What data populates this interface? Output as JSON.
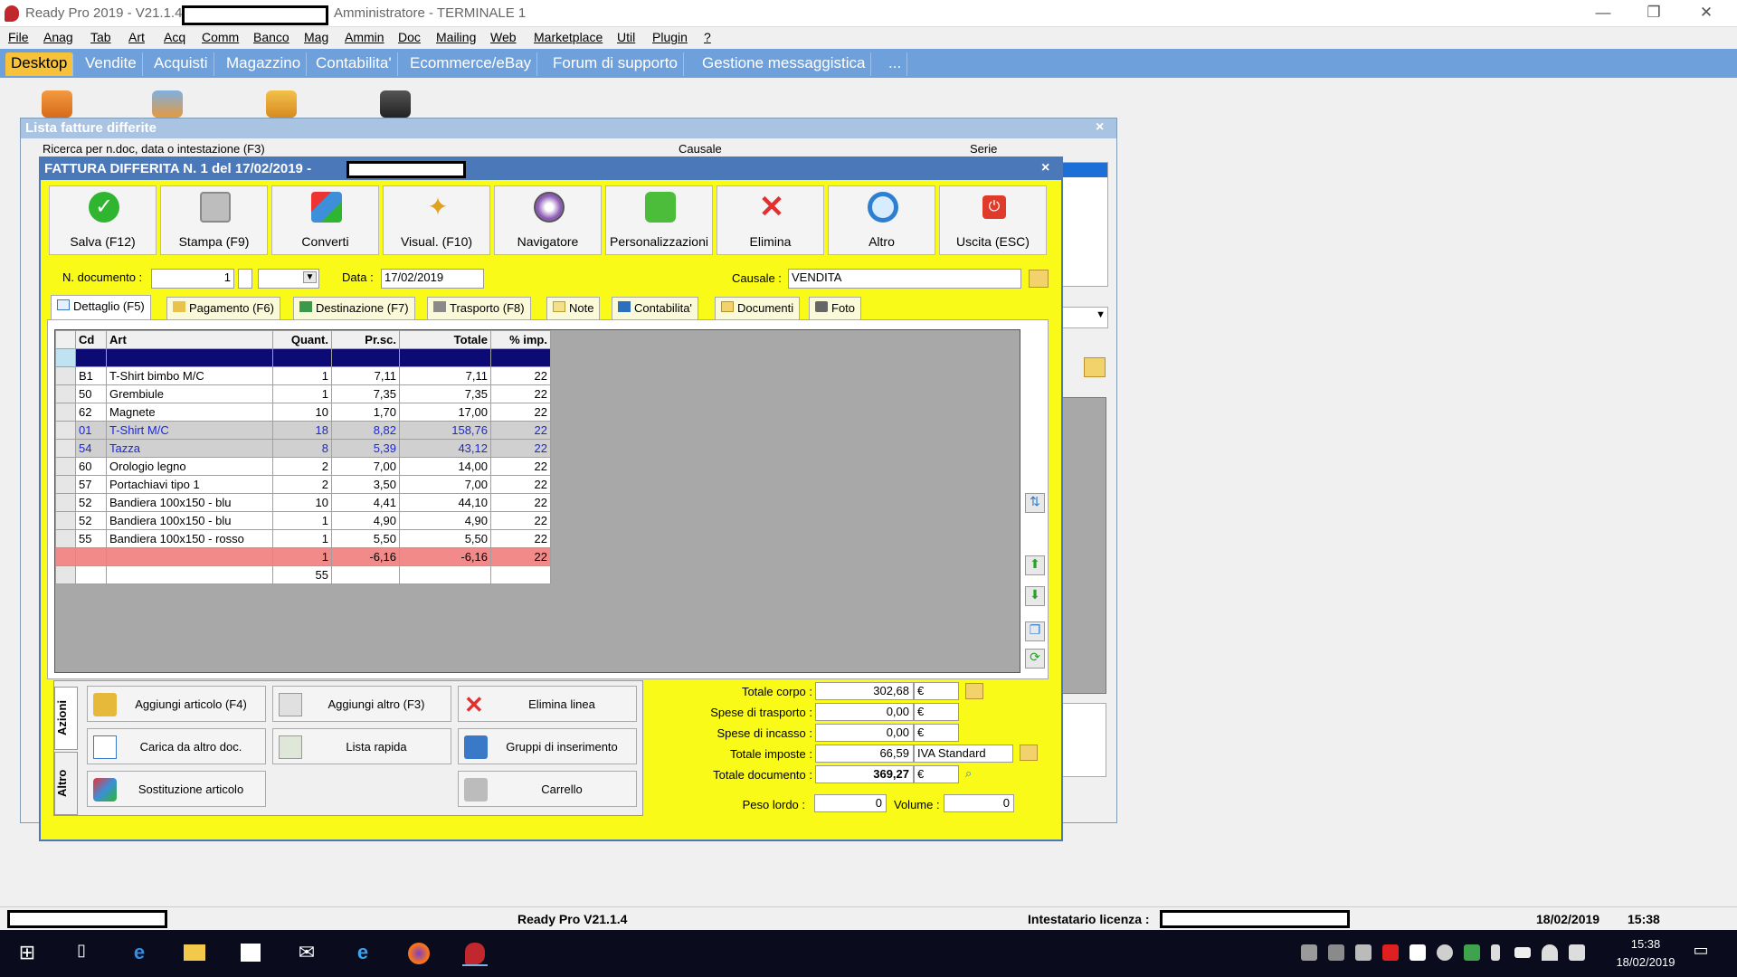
{
  "window": {
    "title": "Ready Pro 2019 - V21.1.4",
    "subtitle": "Amministratore - TERMINALE 1",
    "controls": [
      "—",
      "❐",
      "✕"
    ]
  },
  "menu": [
    "File",
    "Anag",
    "Tab",
    "Art",
    "Acq",
    "Comm",
    "Banco",
    "Mag",
    "Ammin",
    "Doc",
    "Mailing",
    "Web",
    "Marketplace",
    "Util",
    "Plugin",
    "?"
  ],
  "module_tabs": [
    "Desktop",
    "Vendite",
    "Acquisti",
    "Magazzino",
    "Contabilita'",
    "Ecommerce/eBay",
    "Forum di supporto",
    "Gestione messaggistica",
    "..."
  ],
  "back_window": {
    "title": "Lista fatture differite",
    "search_label": "Ricerca per n.doc, data o intestazione (F3)",
    "causale_label": "Causale",
    "serie_label": "Serie",
    "close": "×"
  },
  "dialog": {
    "title": "FATTURA DIFFERITA N. 1 del 17/02/2019 -",
    "close": "×",
    "toolbar": [
      {
        "label": "Salva (F12)",
        "icon": "check-icon",
        "color": "#2fb52f"
      },
      {
        "label": "Stampa (F9)",
        "icon": "printer-icon",
        "color": "#9a9a9a"
      },
      {
        "label": "Converti",
        "icon": "convert-icon",
        "color": "#3c8fd8"
      },
      {
        "label": "Visual. (F10)",
        "icon": "magic-wand-icon",
        "color": "#e0a020"
      },
      {
        "label": "Navigatore",
        "icon": "navigator-icon",
        "color": "#8c5bb4"
      },
      {
        "label": "Personalizzazioni",
        "icon": "puzzle-icon",
        "color": "#4bbd3a"
      },
      {
        "label": "Elimina",
        "icon": "delete-x-icon",
        "color": "#e23030"
      },
      {
        "label": "Altro",
        "icon": "search-icon",
        "color": "#2f7fd0"
      },
      {
        "label": "Uscita (ESC)",
        "icon": "power-icon",
        "color": "#e03a2a"
      }
    ],
    "n_documento_label": "N. documento :",
    "n_documento": "1",
    "data_label": "Data :",
    "data": "17/02/2019",
    "causale_label": "Causale :",
    "causale": "VENDITA",
    "tabs": [
      "Dettaglio (F5)",
      "Pagamento (F6)",
      "Destinazione (F7)",
      "Trasporto (F8)",
      "Note",
      "Contabilita'",
      "Documenti",
      "Foto"
    ],
    "grid": {
      "columns": [
        "Cd",
        "Art",
        "Quant.",
        "Pr.sc.",
        "Totale",
        "% imp."
      ],
      "rows": [
        {
          "cd": "",
          "art": "",
          "q": "",
          "pr": "",
          "tot": "",
          "imp": "",
          "style": "cur"
        },
        {
          "cd": "B1",
          "art": "T-Shirt bimbo M/C",
          "q": "1",
          "pr": "7,11",
          "tot": "7,11",
          "imp": "22",
          "style": ""
        },
        {
          "cd": "50",
          "art": "Grembiule",
          "q": "1",
          "pr": "7,35",
          "tot": "7,35",
          "imp": "22",
          "style": ""
        },
        {
          "cd": "62",
          "art": "Magnete",
          "q": "10",
          "pr": "1,70",
          "tot": "17,00",
          "imp": "22",
          "style": ""
        },
        {
          "cd": "01",
          "art": "T-Shirt M/C",
          "q": "18",
          "pr": "8,82",
          "tot": "158,76",
          "imp": "22",
          "style": "blue"
        },
        {
          "cd": "54",
          "art": "Tazza",
          "q": "8",
          "pr": "5,39",
          "tot": "43,12",
          "imp": "22",
          "style": "blue"
        },
        {
          "cd": "60",
          "art": "Orologio legno",
          "q": "2",
          "pr": "7,00",
          "tot": "14,00",
          "imp": "22",
          "style": ""
        },
        {
          "cd": "57",
          "art": "Portachiavi tipo 1",
          "q": "2",
          "pr": "3,50",
          "tot": "7,00",
          "imp": "22",
          "style": ""
        },
        {
          "cd": "52",
          "art": "Bandiera 100x150 - blu",
          "q": "10",
          "pr": "4,41",
          "tot": "44,10",
          "imp": "22",
          "style": ""
        },
        {
          "cd": "52",
          "art": "Bandiera 100x150 - blu",
          "q": "1",
          "pr": "4,90",
          "tot": "4,90",
          "imp": "22",
          "style": ""
        },
        {
          "cd": "55",
          "art": "Bandiera 100x150 - rosso",
          "q": "1",
          "pr": "5,50",
          "tot": "5,50",
          "imp": "22",
          "style": ""
        },
        {
          "cd": "",
          "art": "",
          "q": "1",
          "pr": "-6,16",
          "tot": "-6,16",
          "imp": "22",
          "style": "red"
        },
        {
          "cd": "",
          "art": "",
          "q": "55",
          "pr": "",
          "tot": "",
          "imp": "",
          "style": "sum"
        }
      ]
    },
    "actions": {
      "tab_azioni": "Azioni",
      "tab_altro": "Altro",
      "buttons": [
        {
          "label": "Aggiungi articolo (F4)",
          "icon": "add-article-icon"
        },
        {
          "label": "Aggiungi altro (F3)",
          "icon": "add-other-icon"
        },
        {
          "label": "Elimina linea",
          "icon": "delete-line-icon"
        },
        {
          "label": "Carica da altro doc.",
          "icon": "load-doc-icon"
        },
        {
          "label": "Lista rapida",
          "icon": "quick-list-icon"
        },
        {
          "label": "Gruppi di inserimento",
          "icon": "insert-groups-icon"
        },
        {
          "label": "Sostituzione articolo",
          "icon": "replace-article-icon"
        },
        {
          "label": "Carrello",
          "icon": "cart-icon"
        }
      ]
    },
    "totals": {
      "totale_corpo_label": "Totale corpo :",
      "totale_corpo": "302,68",
      "spese_trasporto_label": "Spese di trasporto :",
      "spese_trasporto": "0,00",
      "spese_incasso_label": "Spese di incasso :",
      "spese_incasso": "0,00",
      "totale_imposte_label": "Totale imposte :",
      "totale_imposte": "66,59",
      "iva": "IVA Standard",
      "totale_documento_label": "Totale documento :",
      "totale_documento": "369,27",
      "currency": "€",
      "peso_lordo_label": "Peso lordo :",
      "peso_lordo": "0",
      "volume_label": "Volume :",
      "volume": "0"
    }
  },
  "statusbar": {
    "version": "Ready Pro V21.1.4",
    "licenza_label": "Intestatario licenza :",
    "date": "18/02/2019",
    "time": "15:38"
  },
  "taskbar": {
    "clock_time": "15:38",
    "clock_date": "18/02/2019"
  }
}
